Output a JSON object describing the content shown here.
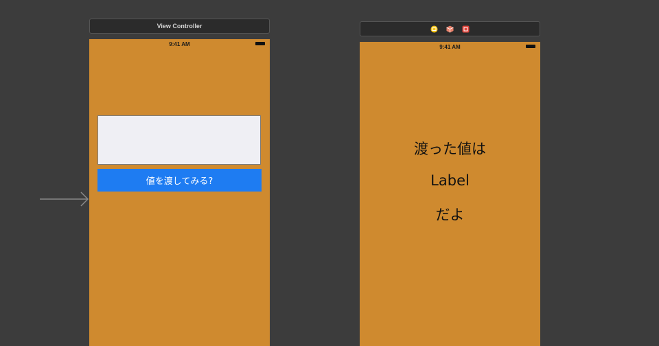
{
  "first_scene": {
    "bar_title": "View Controller",
    "status_time": "9:41 AM",
    "text_field": {
      "value": "",
      "placeholder": ""
    },
    "button_label": "値を渡してみる?"
  },
  "second_scene": {
    "dock_icons": [
      "view-controller-icon",
      "first-responder-icon",
      "exit-icon"
    ],
    "status_time": "9:41 AM",
    "label_top": "渡った値は",
    "label_middle": "Label",
    "label_bottom": "だよ"
  },
  "colors": {
    "canvas": "#3c3c3c",
    "scene_background": "#cf8a2f",
    "button": "#1e7cf2",
    "text_field": "#efeff4",
    "scene_bar": "#2b2b2b"
  }
}
